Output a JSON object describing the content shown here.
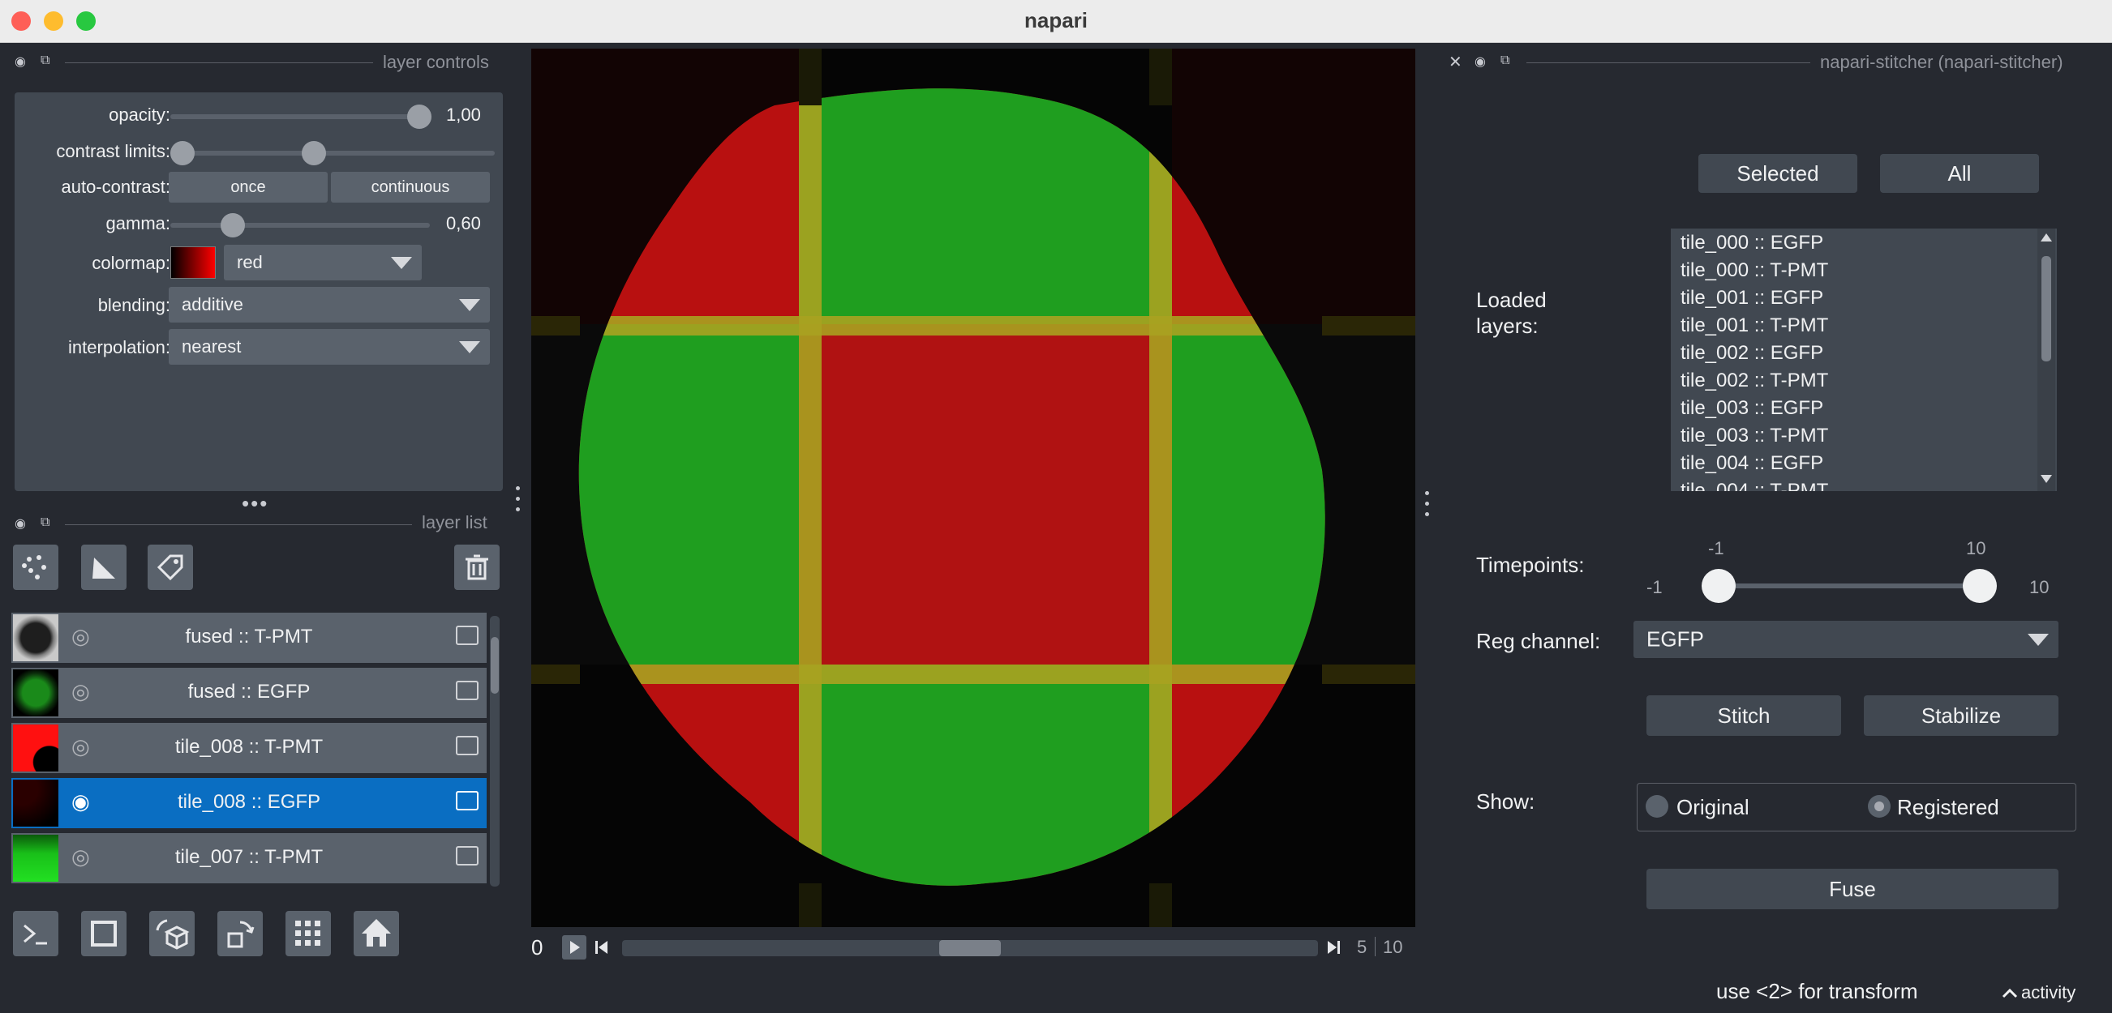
{
  "window": {
    "title": "napari"
  },
  "layer_controls": {
    "header": "layer controls",
    "opacity": {
      "label": "opacity:",
      "value": "1,00",
      "level": 1.0
    },
    "contrast_limits": {
      "label": "contrast limits:",
      "low": 0.0,
      "high": 0.42
    },
    "auto_contrast": {
      "label": "auto-contrast:",
      "once": "once",
      "continuous": "continuous"
    },
    "gamma": {
      "label": "gamma:",
      "value": "0,60",
      "level": 0.25
    },
    "colormap": {
      "label": "colormap:",
      "value": "red"
    },
    "blending": {
      "label": "blending:",
      "value": "additive"
    },
    "interpolation": {
      "label": "interpolation:",
      "value": "nearest"
    }
  },
  "layer_list": {
    "header": "layer list",
    "layers": [
      {
        "name": "fused :: T-PMT",
        "visible": false,
        "selected": false
      },
      {
        "name": "fused :: EGFP",
        "visible": false,
        "selected": false
      },
      {
        "name": "tile_008 :: T-PMT",
        "visible": false,
        "selected": false
      },
      {
        "name": "tile_008 :: EGFP",
        "visible": true,
        "selected": true
      },
      {
        "name": "tile_007 :: T-PMT",
        "visible": false,
        "selected": false
      }
    ]
  },
  "dims": {
    "current": "0",
    "position": "5",
    "total": "10",
    "level": 0.5
  },
  "stitcher": {
    "header": "napari-stitcher (napari-stitcher)",
    "selected_button": "Selected",
    "all_button": "All",
    "loaded_layers_label": "Loaded layers:",
    "loaded_layers": [
      "tile_000 :: EGFP",
      "tile_000 :: T-PMT",
      "tile_001 :: EGFP",
      "tile_001 :: T-PMT",
      "tile_002 :: EGFP",
      "tile_002 :: T-PMT",
      "tile_003 :: EGFP",
      "tile_003 :: T-PMT",
      "tile_004 :: EGFP",
      "tile_004 :: T-PMT"
    ],
    "timepoints": {
      "label": "Timepoints:",
      "min": "-1",
      "max": "10",
      "low": "-1",
      "high": "10"
    },
    "reg_channel": {
      "label": "Reg channel:",
      "value": "EGFP"
    },
    "stitch_button": "Stitch",
    "stabilize_button": "Stabilize",
    "show": {
      "label": "Show:",
      "original": "Original",
      "registered": "Registered",
      "selected": "Registered"
    },
    "fuse_button": "Fuse"
  },
  "status": {
    "message": "use <2> for transform",
    "activity": "activity"
  },
  "colors": {
    "background": "#262930",
    "panel": "#414851",
    "button": "#5a626c",
    "accent": "#0a6ec2"
  }
}
